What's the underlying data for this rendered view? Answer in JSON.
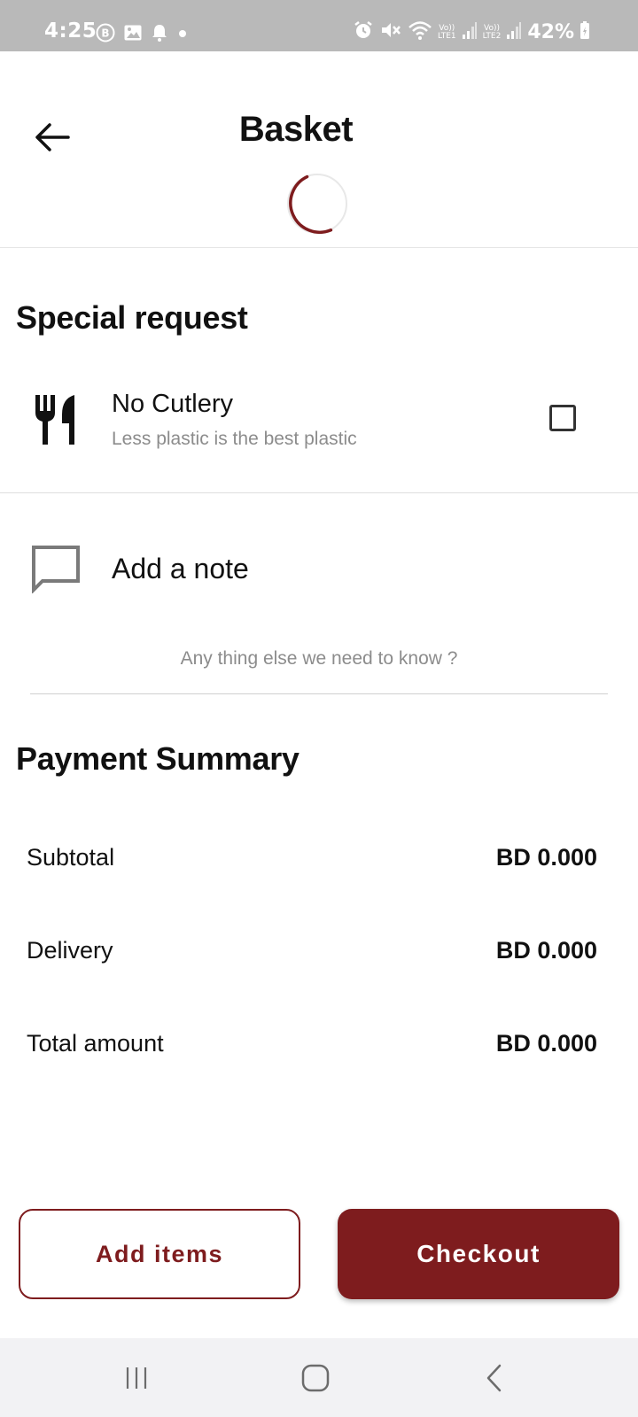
{
  "status_bar": {
    "time": "4:25",
    "left_icons": [
      "b-circle-icon",
      "image-icon",
      "bell-icon",
      "dot-icon"
    ],
    "right_icons": [
      "alarm-icon",
      "mute-icon",
      "wifi-icon",
      "signal-icon",
      "signal-icon",
      "battery-icon"
    ],
    "sim1_label_top": "Vo))",
    "sim1_label_bottom": "LTE1",
    "sim2_label_top": "Vo))",
    "sim2_label_bottom": "LTE2",
    "battery": "42%"
  },
  "header": {
    "title": "Basket",
    "back_icon": "arrow-left-icon",
    "loading": true
  },
  "special_request": {
    "title": "Special request",
    "cutlery": {
      "icon": "cutlery-icon",
      "label": "No Cutlery",
      "sublabel": "Less plastic is the best plastic",
      "checked": false
    },
    "note": {
      "icon": "message-icon",
      "label": "Add a note",
      "value": "",
      "placeholder": "Any thing else we need to know ?"
    }
  },
  "payment_summary": {
    "title": "Payment Summary",
    "rows": [
      {
        "label": "Subtotal",
        "value": "BD 0.000"
      },
      {
        "label": "Delivery",
        "value": "BD 0.000"
      },
      {
        "label": "Total amount",
        "value": "BD 0.000"
      }
    ]
  },
  "actions": {
    "add_items_label": "Add items",
    "checkout_label": "Checkout"
  },
  "nav_bar": {
    "icons": [
      "recent-apps-icon",
      "home-icon",
      "back-icon"
    ]
  },
  "colors": {
    "brand": "#7e1c1e",
    "status_bar": "#b9b9b9",
    "muted_text": "#8c8c8c",
    "nav_bar": "#f2f2f4"
  }
}
